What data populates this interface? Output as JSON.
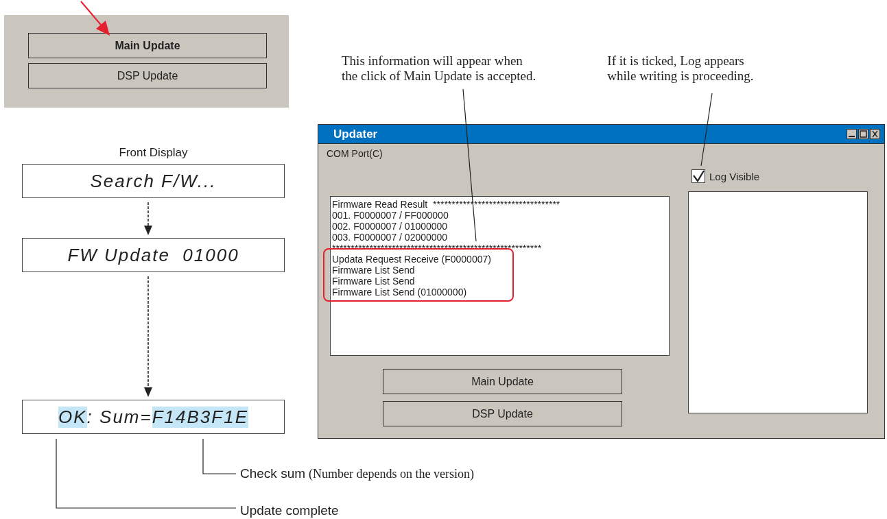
{
  "panel": {
    "buttons": [
      {
        "label": "Main Update",
        "selected": true
      },
      {
        "label": "DSP Update",
        "selected": false
      }
    ]
  },
  "front_display": {
    "title": "Front Display",
    "screens": [
      {
        "segments": [
          {
            "text": "Search F/W...",
            "highlighted": false
          }
        ]
      },
      {
        "segments": [
          {
            "text": "FW Update  01000",
            "highlighted": false
          }
        ]
      },
      {
        "segments": [
          {
            "text": "OK",
            "highlighted": true
          },
          {
            "text": ": Sum=",
            "highlighted": false
          },
          {
            "text": "F14B3F1E",
            "highlighted": true
          }
        ]
      }
    ]
  },
  "callouts": [
    {
      "lines": [
        "This information will appear when",
        "the click of Main Update is accepted."
      ]
    },
    {
      "lines": [
        "If it is ticked, Log appears",
        "while writing is proceeding."
      ]
    }
  ],
  "window": {
    "title": "Updater",
    "menu": "COM Port(C)",
    "log_lines": [
      "Firmware Read Result  **********************************",
      "001. F0000007 / FF000000",
      "002. F0000007 / 01000000",
      "003. F0000007 / 02000000",
      "********************************************************"
    ],
    "outlined_lines": [
      "Updata Request Receive (F0000007)",
      "Firmware List Send",
      "Firmware List Send",
      "Firmware List Send (01000000)"
    ],
    "buttons": [
      "Main Update",
      "DSP Update"
    ],
    "log_visible": {
      "label": "Log Visible",
      "checked": true
    }
  },
  "notes": [
    {
      "label": "Check sum",
      "detail": "(Number depends on the version)"
    },
    {
      "label": "Update complete"
    }
  ]
}
